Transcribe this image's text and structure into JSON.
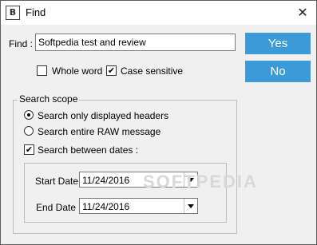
{
  "window": {
    "title": "Find",
    "app_icon_glyph": "B",
    "close_glyph": "✕"
  },
  "find": {
    "label": "Find :",
    "value": "Softpedia test and review"
  },
  "buttons": {
    "yes_label": "Yes",
    "no_label": "No",
    "accent_color": "#3d9ad8"
  },
  "options": {
    "whole_word": {
      "label": "Whole word",
      "checked": false
    },
    "case_sensitive": {
      "label": "Case sensitive",
      "checked": true
    }
  },
  "search_scope": {
    "title": "Search scope",
    "radio_headers": {
      "label": "Search only displayed headers",
      "selected": true
    },
    "radio_raw": {
      "label": "Search entire RAW message",
      "selected": false
    },
    "between_dates": {
      "label": "Search between dates :",
      "checked": true
    },
    "start_date": {
      "label": "Start Date :",
      "value": "11/24/2016"
    },
    "end_date": {
      "label": "End Date :",
      "value": "11/24/2016"
    }
  },
  "watermark": "SOFTPEDIA"
}
